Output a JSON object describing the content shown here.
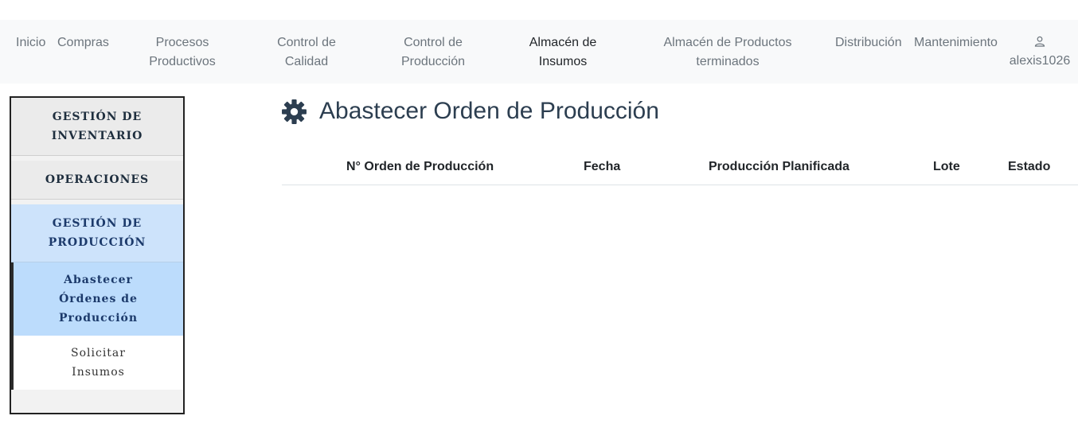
{
  "nav": {
    "items": [
      {
        "label": "Inicio"
      },
      {
        "label": "Compras"
      },
      {
        "line1": "Procesos",
        "line2": "Productivos"
      },
      {
        "line1": "Control de",
        "line2": "Calidad"
      },
      {
        "line1": "Control de",
        "line2": "Producción"
      },
      {
        "line1": "Almacén de",
        "line2": "Insumos"
      },
      {
        "line1": "Almacén de Productos",
        "line2": "terminados"
      },
      {
        "label": "Distribución"
      },
      {
        "label": "Mantenimiento"
      }
    ],
    "user": {
      "name": "alexis1026",
      "icon": "user-icon"
    }
  },
  "sidebar": {
    "inventario": {
      "line1": "GESTIÓN DE",
      "line2": "INVENTARIO"
    },
    "operaciones": "OPERACIONES",
    "produccion": {
      "line1": "GESTIÓN DE",
      "line2": "PRODUCCIÓN"
    },
    "abastecer": {
      "line1": "Abastecer",
      "line2": "Órdenes de",
      "line3": "Producción"
    },
    "solicitar": {
      "line1": "Solicitar",
      "line2": "Insumos"
    }
  },
  "main": {
    "title": "Abastecer Orden de Producción",
    "title_icon": "gear-icon",
    "table": {
      "headers": [
        "N° Orden de Producción",
        "Fecha",
        "Producción Planificada",
        "Lote",
        "Estado"
      ],
      "rows": []
    }
  },
  "colors": {
    "navbar_bg": "#f8f9fa",
    "sidebar_active_bg": "#bcdcfc",
    "sidebar_section_bg": "#cde3fb",
    "title_color": "#2c3e50"
  }
}
